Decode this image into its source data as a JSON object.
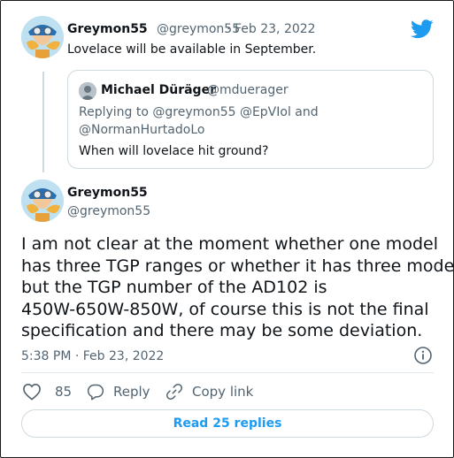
{
  "colors": {
    "accent": "#1d9bf0",
    "muted": "#536471",
    "text": "#0f1419",
    "border": "#cfd9de"
  },
  "top_tweet": {
    "display_name": "Greymon55",
    "handle": "@greymon55",
    "separator": "·",
    "date": "Feb 23, 2022",
    "text": "Lovelace will be available in September.",
    "avatar_icon": "avatar-icon"
  },
  "quoted_tweet": {
    "display_name": "Michael Düräger",
    "handle": "@mdueragеr",
    "reply_line1": "Replying to @greymon55 @EpVIol and",
    "reply_line2": "@NormanHurtadoLo",
    "text": "When will lovelace hit ground?"
  },
  "main_tweet": {
    "display_name": "Greymon55",
    "handle": "@greymon55",
    "text_lines": [
      "I am not clear at the moment whether one model",
      "has three TGP ranges or whether it has three models",
      "but the TGP number of the AD102 is",
      "450W-650W-850W, of course this is not the final",
      "specification and there may be some deviation."
    ],
    "timestamp": "5:38 PM · Feb 23, 2022"
  },
  "actions": {
    "like_count": "85",
    "reply_label": "Reply",
    "copy_link_label": "Copy link"
  },
  "read_replies_label": "Read 25 replies",
  "icons": {
    "bird": "twitter-bird-icon",
    "info": "info-icon",
    "heart": "heart-icon",
    "reply": "reply-icon",
    "link": "link-icon"
  }
}
